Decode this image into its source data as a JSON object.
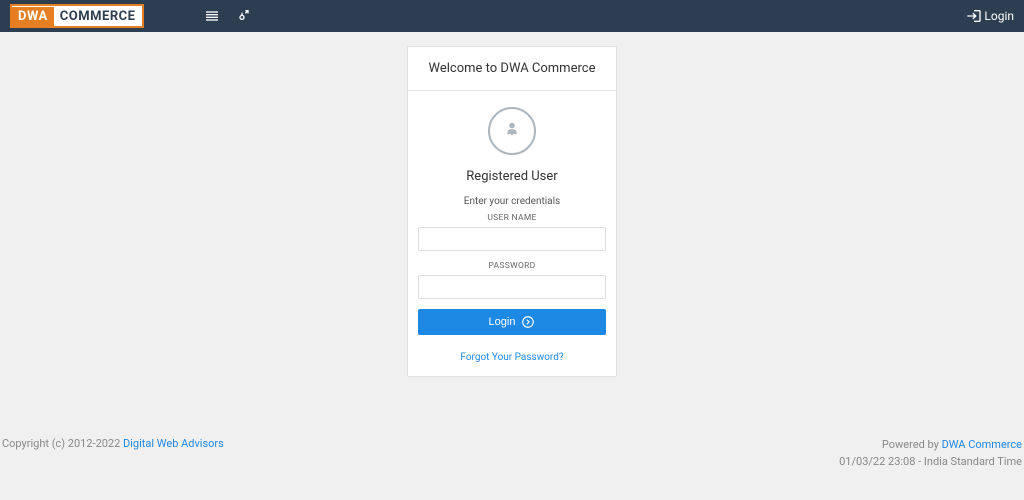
{
  "logo": {
    "part1": "DWA",
    "part2": "COMMERCE"
  },
  "header": {
    "login_label": "Login"
  },
  "card": {
    "title": "Welcome to DWA Commerce",
    "registered_user": "Registered User",
    "enter_credentials": "Enter your credentials",
    "username_label": "USER NAME",
    "password_label": "PASSWORD",
    "login_button": "Login",
    "forgot_password": "Forgot Your Password?"
  },
  "footer": {
    "copyright_prefix": "Copyright (c) 2012-2022 ",
    "copyright_link": "Digital Web Advisors",
    "powered_prefix": "Powered by ",
    "powered_link": "DWA Commerce",
    "timestamp": "01/03/22 23:08 - India Standard Time"
  }
}
